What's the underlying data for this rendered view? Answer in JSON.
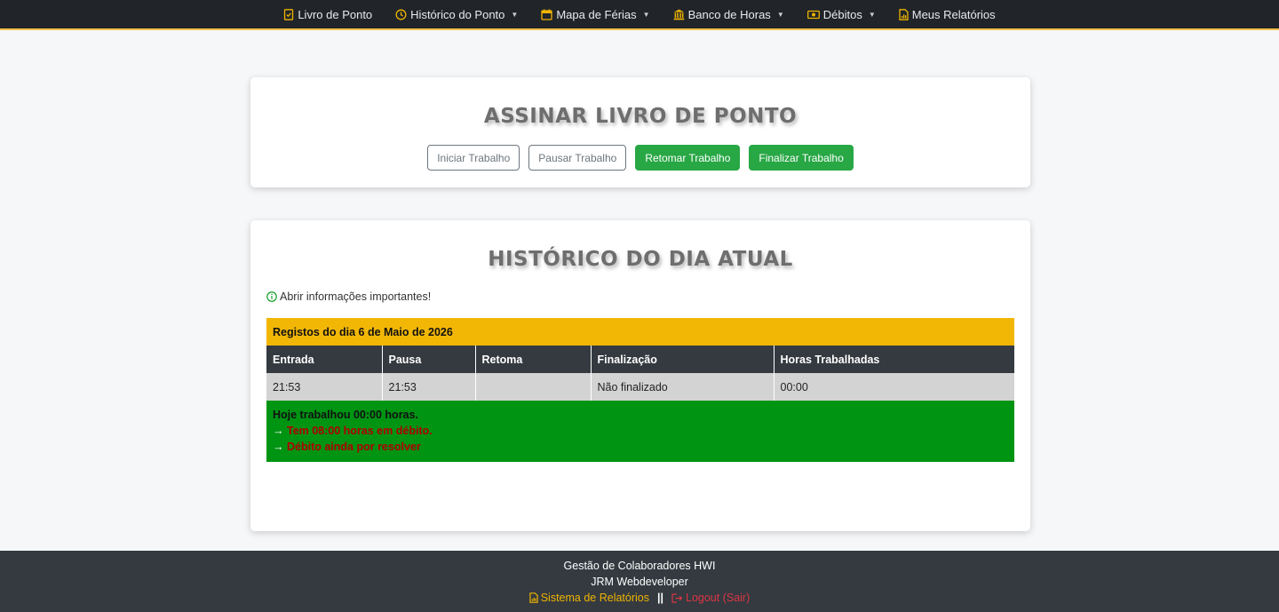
{
  "colors": {
    "accent": "#f0b400",
    "navbar": "#212529",
    "success": "#28a745",
    "summary": "#009413",
    "date_row": "#f2b705",
    "debt_text": "#b00000",
    "logout": "#dc3545"
  },
  "nav": {
    "items": [
      {
        "label": "Livro de Ponto",
        "icon": "journal-check-icon",
        "dropdown": false
      },
      {
        "label": "Histórico do Ponto",
        "icon": "clock-icon",
        "dropdown": true
      },
      {
        "label": "Mapa de Férias",
        "icon": "calendar-icon",
        "dropdown": true
      },
      {
        "label": "Banco de Horas",
        "icon": "bank-icon",
        "dropdown": true
      },
      {
        "label": "Débitos",
        "icon": "cash-icon",
        "dropdown": true
      },
      {
        "label": "Meus Relatórios",
        "icon": "file-chart-icon",
        "dropdown": false
      }
    ]
  },
  "sign": {
    "title": "ASSINAR LIVRO DE PONTO",
    "buttons": {
      "start": "Iniciar Trabalho",
      "pause": "Pausar Trabalho",
      "resume": "Retomar Trabalho",
      "finish": "Finalizar Trabalho"
    }
  },
  "history": {
    "title": "HISTÓRICO DO DIA ATUAL",
    "info_link": "Abrir informações importantes!",
    "date_row": "Registos do dia 6 de Maio de 2026",
    "columns": [
      "Entrada",
      "Pausa",
      "Retoma",
      "Finalização",
      "Horas Trabalhadas"
    ],
    "row": [
      "21:53",
      "21:53",
      "",
      "Não finalizado",
      "00:00"
    ],
    "summary": {
      "worked": "Hoje trabalhou 00:00 horas.",
      "arrow": "→",
      "debt": "Tem 08:00 horas em débito.",
      "pending": "Débito ainda por resolver"
    }
  },
  "footer": {
    "line1": "Gestão de Colaboradores HWI",
    "line2": "JRM Webdeveloper",
    "reports_link": "Sistema de Relatórios",
    "separator": "||",
    "logout_link": "Logout (Sair)"
  }
}
